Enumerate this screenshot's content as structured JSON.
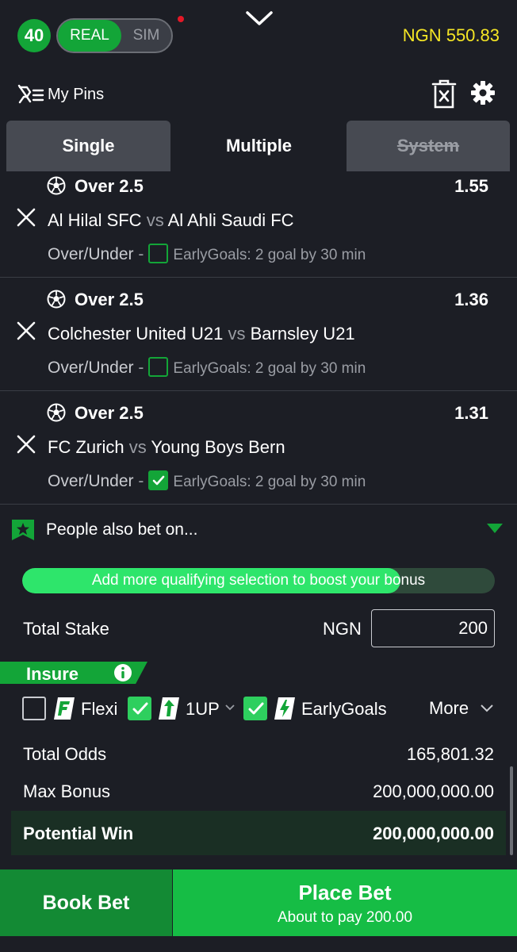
{
  "header": {
    "count": "40",
    "mode_real": "REAL",
    "mode_sim": "SIM",
    "balance": "NGN 550.83"
  },
  "toolbar": {
    "pins_label": "My Pins"
  },
  "tabs": {
    "single": "Single",
    "multiple": "Multiple",
    "system": "System"
  },
  "selections": [
    {
      "pick": "Over 2.5",
      "odds": "1.55",
      "home": "Al Hilal SFC",
      "vs": "vs",
      "away": "Al Ahli Saudi FC",
      "market": "Over/Under",
      "dash": "-",
      "early_goals": "EarlyGoals: 2 goal by 30 min",
      "early_goals_checked": false
    },
    {
      "pick": "Over 2.5",
      "odds": "1.36",
      "home": "Colchester United U21",
      "vs": "vs",
      "away": "Barnsley U21",
      "market": "Over/Under",
      "dash": "-",
      "early_goals": "EarlyGoals: 2 goal by 30 min",
      "early_goals_checked": false
    },
    {
      "pick": "Over 2.5",
      "odds": "1.31",
      "home": "FC Zurich",
      "vs": "vs",
      "away": "Young Boys Bern",
      "market": "Over/Under",
      "dash": "-",
      "early_goals": "EarlyGoals: 2 goal by 30 min",
      "early_goals_checked": true
    }
  ],
  "people_also_bet": "People also bet on...",
  "bonus_progress": {
    "text": "Add more qualifying selection to boost your bonus",
    "fraction": 0.8
  },
  "stake": {
    "label": "Total Stake",
    "currency": "NGN",
    "value": "200"
  },
  "insure": {
    "label": "Insure",
    "options": [
      {
        "label": "Flexi",
        "checked": false
      },
      {
        "label": "1UP",
        "checked": true
      },
      {
        "label": "EarlyGoals",
        "checked": true
      }
    ],
    "more_label": "More"
  },
  "totals": {
    "odds_label": "Total Odds",
    "odds_value": "165,801.32",
    "bonus_label": "Max Bonus",
    "bonus_value": "200,000,000.00",
    "win_label": "Potential Win",
    "win_value": "200,000,000.00"
  },
  "actions": {
    "book_bet": "Book Bet",
    "place_bet": "Place Bet",
    "place_sub": "About to pay 200.00"
  },
  "colors": {
    "accent_green": "#13a538",
    "balance_yellow": "#f5e625",
    "background": "#1c1e25"
  }
}
